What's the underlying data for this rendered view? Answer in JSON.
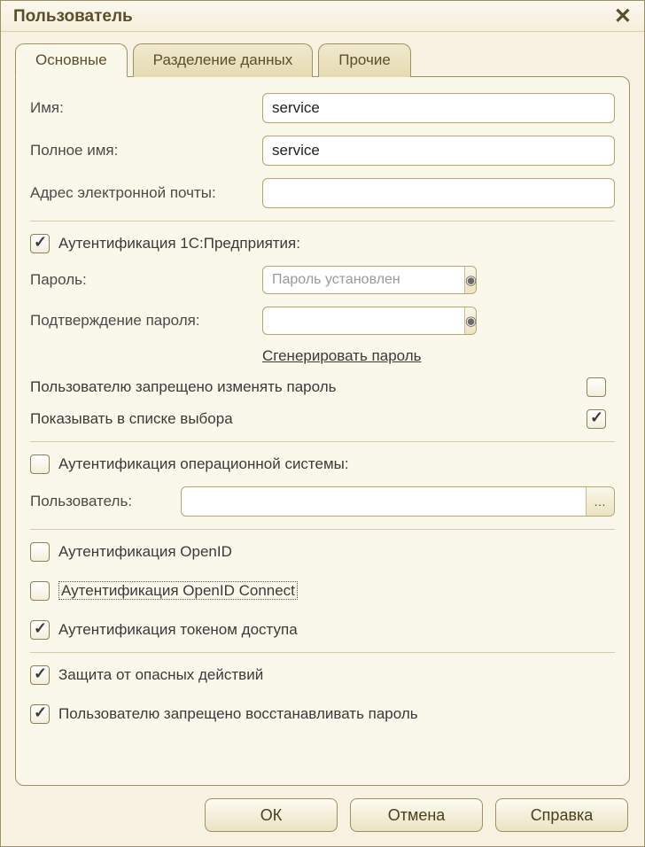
{
  "title": "Пользователь",
  "tabs": {
    "main": "Основные",
    "split": "Разделение данных",
    "other": "Прочие"
  },
  "fields": {
    "name_label": "Имя:",
    "name_value": "service",
    "fullname_label": "Полное имя:",
    "fullname_value": "service",
    "email_label": "Адрес электронной почты:",
    "email_value": "",
    "auth1c_label": "Аутентификация 1С:Предприятия:",
    "password_label": "Пароль:",
    "password_placeholder": "Пароль установлен",
    "password_confirm_label": "Подтверждение пароля:",
    "generate_link": "Сгенерировать пароль",
    "forbid_change_label": "Пользователю запрещено изменять пароль",
    "show_in_list_label": "Показывать в списке выбора",
    "os_auth_label": "Аутентификация операционной системы:",
    "os_user_label": "Пользователь:",
    "os_user_value": "",
    "openid_label": "Аутентификация OpenID",
    "openid_connect_label": "Аутентификация OpenID Connect",
    "token_auth_label": "Аутентификация токеном доступа",
    "protect_label": "Защита от опасных действий",
    "forbid_restore_label": "Пользователю запрещено восстанавливать пароль"
  },
  "checks": {
    "auth1c": true,
    "forbid_change": false,
    "show_in_list": true,
    "os_auth": false,
    "openid": false,
    "openid_connect": false,
    "token_auth": true,
    "protect": true,
    "forbid_restore": true
  },
  "buttons": {
    "ok": "ОК",
    "cancel": "Отмена",
    "help": "Справка"
  }
}
